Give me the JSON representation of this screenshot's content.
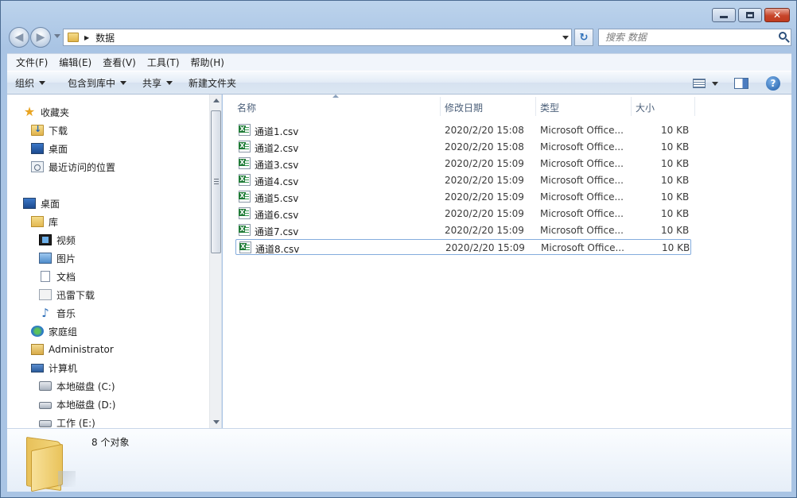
{
  "window": {
    "caption_min": "–",
    "caption_max": "□",
    "caption_close": "✕"
  },
  "nav": {
    "back_glyph": "◀",
    "forward_glyph": "▶",
    "address_path": "数据",
    "address_sep": "▶",
    "refresh_glyph": "↻",
    "search_placeholder": "搜索 数据"
  },
  "menu": [
    "文件(F)",
    "编辑(E)",
    "查看(V)",
    "工具(T)",
    "帮助(H)"
  ],
  "commands": {
    "organize": "组织",
    "include_in_library": "包含到库中",
    "share": "共享",
    "new_folder": "新建文件夹",
    "help_glyph": "?"
  },
  "sidebar": {
    "favorites": {
      "label": "收藏夹",
      "items": [
        "下载",
        "桌面",
        "最近访问的位置"
      ]
    },
    "desktop": "桌面",
    "libraries": {
      "label": "库",
      "items": [
        "视频",
        "图片",
        "文档",
        "迅雷下载",
        "音乐"
      ]
    },
    "homegroup": "家庭组",
    "user": "Administrator",
    "computer": {
      "label": "计算机",
      "items": [
        "本地磁盘 (C:)",
        "本地磁盘 (D:)",
        "工作 (E:)"
      ]
    }
  },
  "columns": {
    "name": "名称",
    "modified": "修改日期",
    "type": "类型",
    "size": "大小"
  },
  "files": [
    {
      "name": "通道1.csv",
      "modified": "2020/2/20 15:08",
      "type": "Microsoft Office...",
      "size": "10 KB"
    },
    {
      "name": "通道2.csv",
      "modified": "2020/2/20 15:08",
      "type": "Microsoft Office...",
      "size": "10 KB"
    },
    {
      "name": "通道3.csv",
      "modified": "2020/2/20 15:09",
      "type": "Microsoft Office...",
      "size": "10 KB"
    },
    {
      "name": "通道4.csv",
      "modified": "2020/2/20 15:09",
      "type": "Microsoft Office...",
      "size": "10 KB"
    },
    {
      "name": "通道5.csv",
      "modified": "2020/2/20 15:09",
      "type": "Microsoft Office...",
      "size": "10 KB"
    },
    {
      "name": "通道6.csv",
      "modified": "2020/2/20 15:09",
      "type": "Microsoft Office...",
      "size": "10 KB"
    },
    {
      "name": "通道7.csv",
      "modified": "2020/2/20 15:09",
      "type": "Microsoft Office...",
      "size": "10 KB"
    },
    {
      "name": "通道8.csv",
      "modified": "2020/2/20 15:09",
      "type": "Microsoft Office...",
      "size": "10 KB"
    }
  ],
  "selected_file_index": 7,
  "details": {
    "item_count": "8 个对象"
  },
  "colors": {
    "selection_border": "#84acdd",
    "chrome_blue": "#a9c4e4",
    "close_red": "#c7452a"
  }
}
